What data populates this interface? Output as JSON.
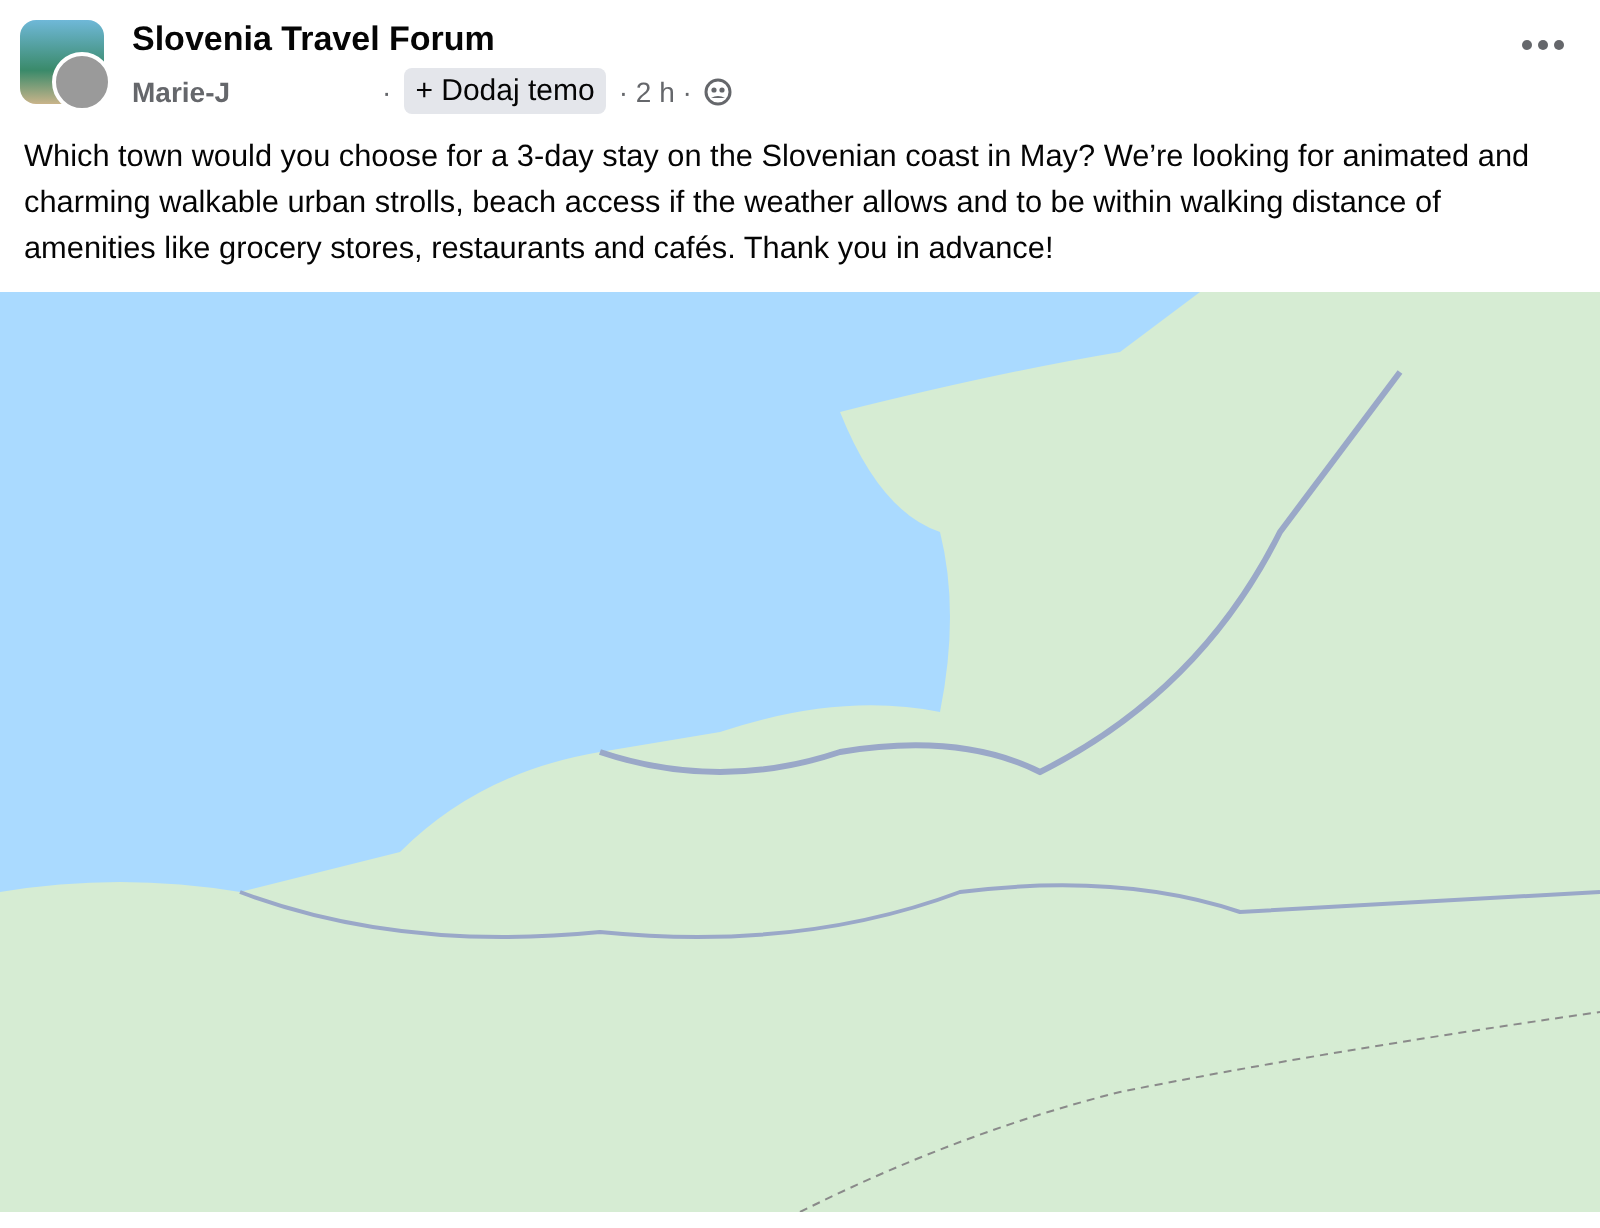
{
  "group": {
    "name": "Slovenia Travel Forum"
  },
  "author": {
    "name": "Marie-J",
    "separator": "·"
  },
  "join_button": {
    "label": "+ Dodaj temo"
  },
  "time": "· 2 h ·",
  "post": {
    "text": "Which town would you choose for a 3-day stay on the Slovenian coast in May? We’re looking for animated and charming walkable urban strolls, beach access if the weather allows and to be within walking distance of amenities like grocery stores, restaurants and cafés. Thank you in advance!"
  }
}
